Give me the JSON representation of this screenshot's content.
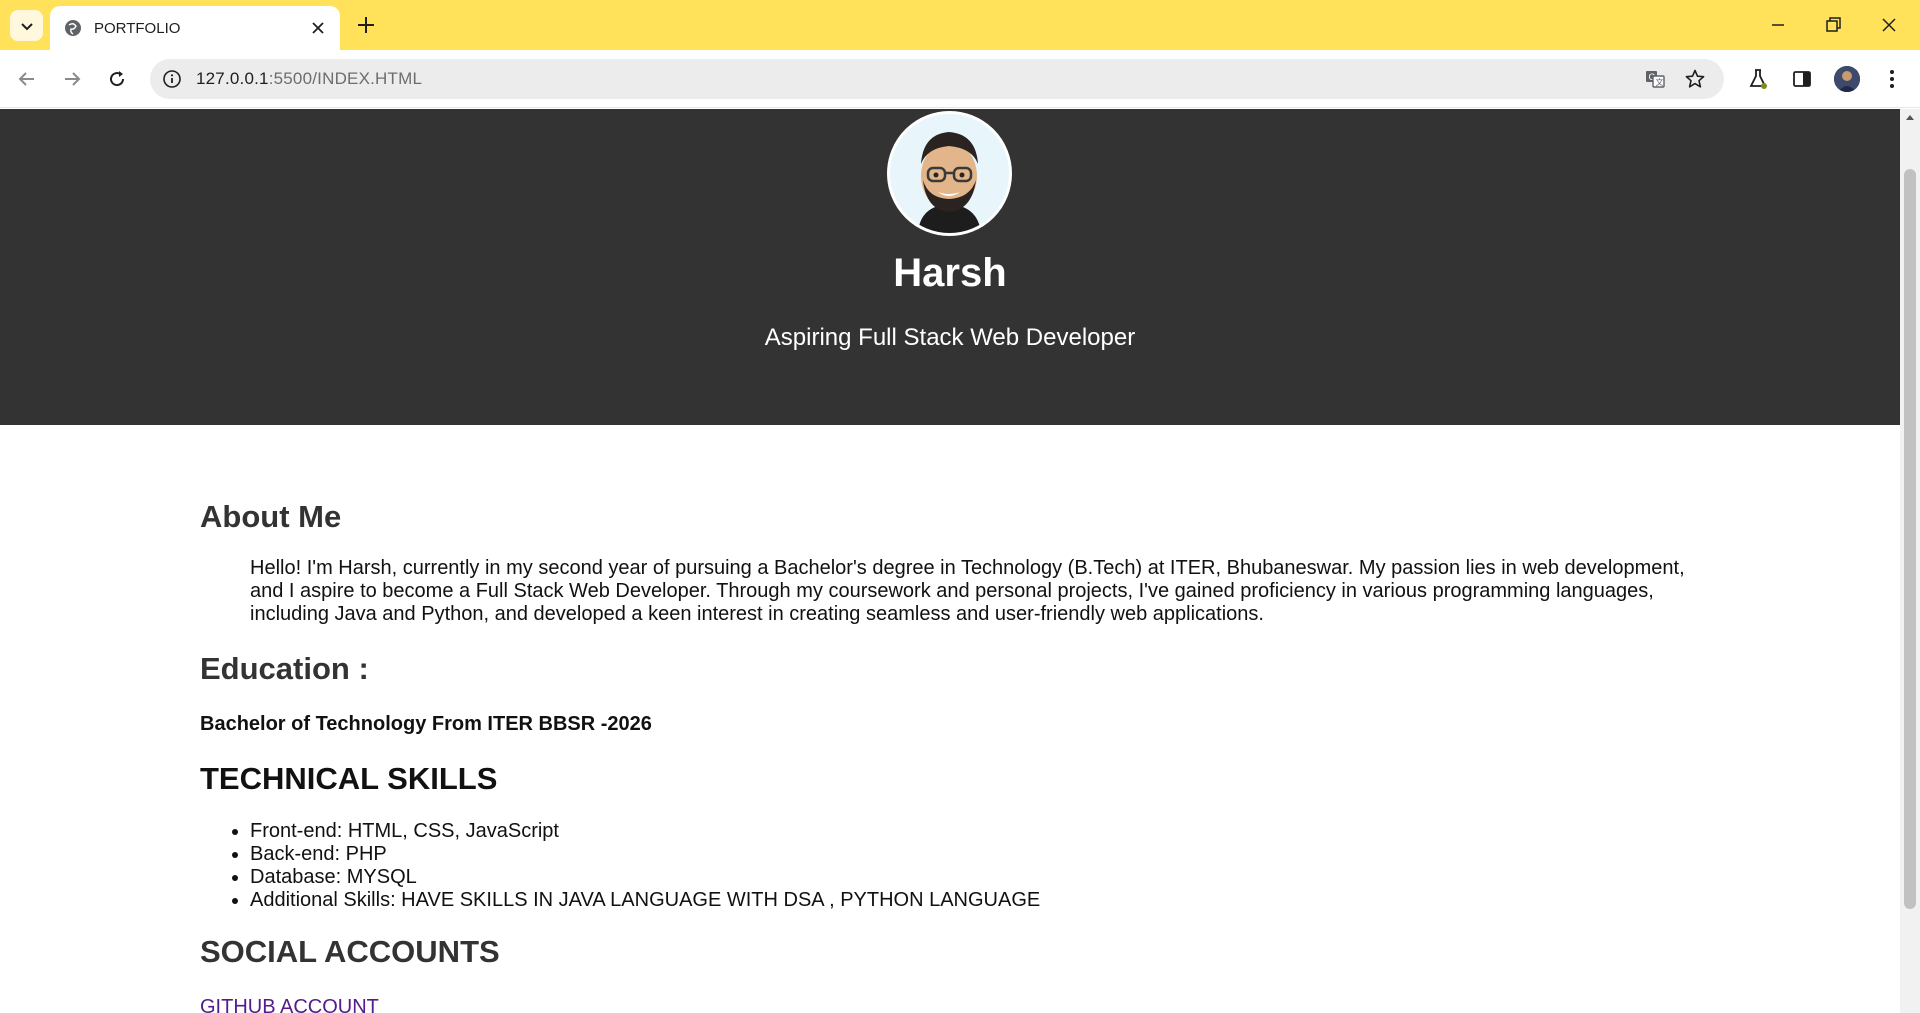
{
  "browser": {
    "tab_title": "PORTFOLIO",
    "url_host": "127.0.0.1",
    "url_rest": ":5500/INDEX.HTML",
    "tabbar_color": "#ffe15a"
  },
  "hero": {
    "name": "Harsh",
    "tagline": "Aspiring Full Stack Web Developer",
    "background": "#333333"
  },
  "about": {
    "heading": "About Me",
    "text": "Hello! I'm Harsh, currently in my second year of pursuing a Bachelor's degree in Technology (B.Tech) at ITER, Bhubaneswar. My passion lies in web development, and I aspire to become a Full Stack Web Developer. Through my coursework and personal projects, I've gained proficiency in various programming languages, including Java and Python, and developed a keen interest in creating seamless and user-friendly web applications."
  },
  "education": {
    "heading": "Education :",
    "line": "Bachelor of Technology From ITER BBSR -2026"
  },
  "skills": {
    "heading": "TECHNICAL SKILLS",
    "items": [
      "Front-end: HTML, CSS, JavaScript",
      "Back-end: PHP",
      "Database: MYSQL",
      "Additional Skills: HAVE SKILLS IN JAVA LANGUAGE WITH DSA , PYTHON LANGUAGE"
    ]
  },
  "social": {
    "heading": "SOCIAL ACCOUNTS",
    "github_label": "GITHUB ACCOUNT"
  },
  "icons": {
    "tab_search": "chevron-down-icon",
    "tab_favicon": "globe-icon",
    "tab_close": "close-icon",
    "new_tab": "plus-icon",
    "back": "back-arrow-icon",
    "forward": "forward-arrow-icon",
    "reload": "reload-icon",
    "site_info": "info-icon",
    "translate": "translate-icon",
    "bookmark": "star-icon",
    "labs": "flask-icon",
    "side_panel": "side-panel-icon",
    "menu": "kebab-menu-icon"
  }
}
